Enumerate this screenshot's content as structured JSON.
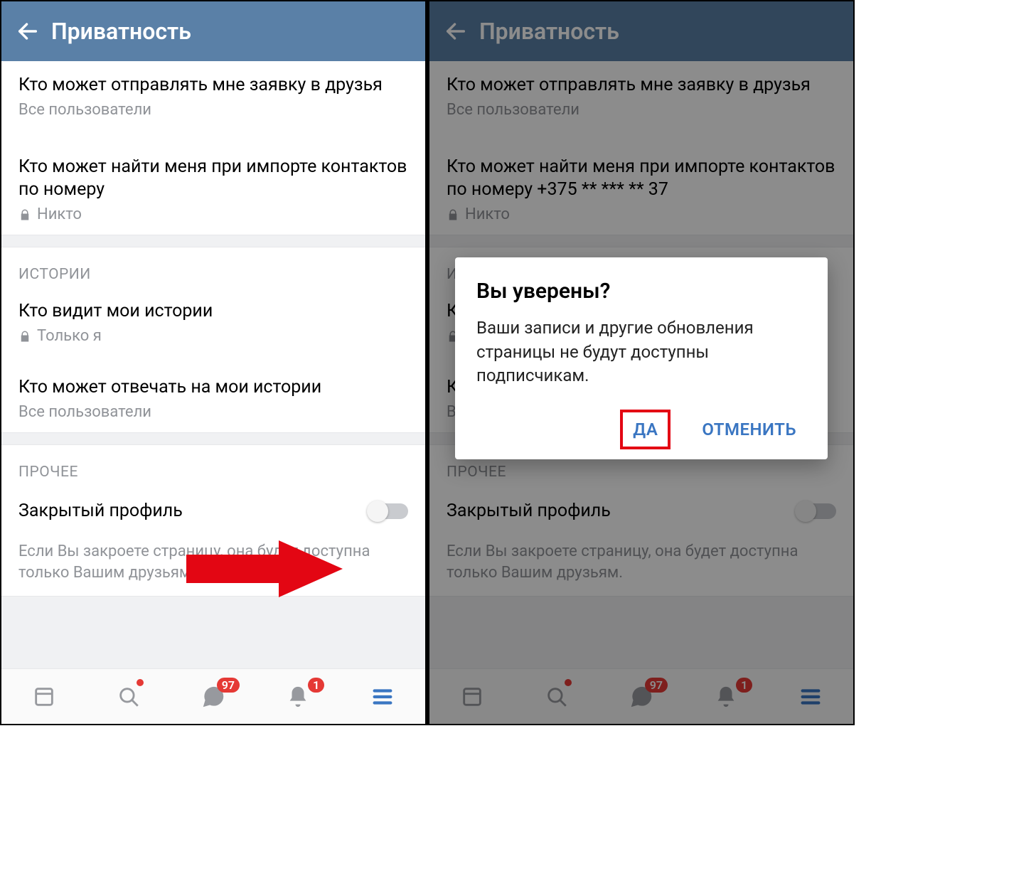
{
  "header_title": "Приватность",
  "left": {
    "friend_req": {
      "title": "Кто может отправлять мне заявку в друзья",
      "value": "Все пользователи"
    },
    "find_contacts": {
      "title": "Кто может найти меня при импорте контактов по номеру",
      "value": "Никто"
    },
    "section_stories": "ИСТОРИИ",
    "who_sees_stories": {
      "title": "Кто видит мои истории",
      "value": "Только я"
    },
    "who_replies_stories": {
      "title": "Кто может отвечать на мои истории",
      "value": "Все пользователи"
    },
    "section_other": "ПРОЧЕЕ",
    "closed_profile": {
      "label": "Закрытый профиль",
      "hint": "Если Вы закроете страницу, она будет доступна только Вашим друзьям."
    }
  },
  "right": {
    "find_contacts": {
      "title": "Кто может найти меня при импорте контактов по номеру +375 ** *** ** 37",
      "value": "Никто"
    },
    "dialog": {
      "title": "Вы уверены?",
      "body": "Ваши записи и другие обновления страницы не будут доступны подписчикам.",
      "yes": "ДА",
      "cancel": "ОТМЕНИТЬ"
    }
  },
  "nav": {
    "messages_badge": "97",
    "notif_badge": "1"
  }
}
